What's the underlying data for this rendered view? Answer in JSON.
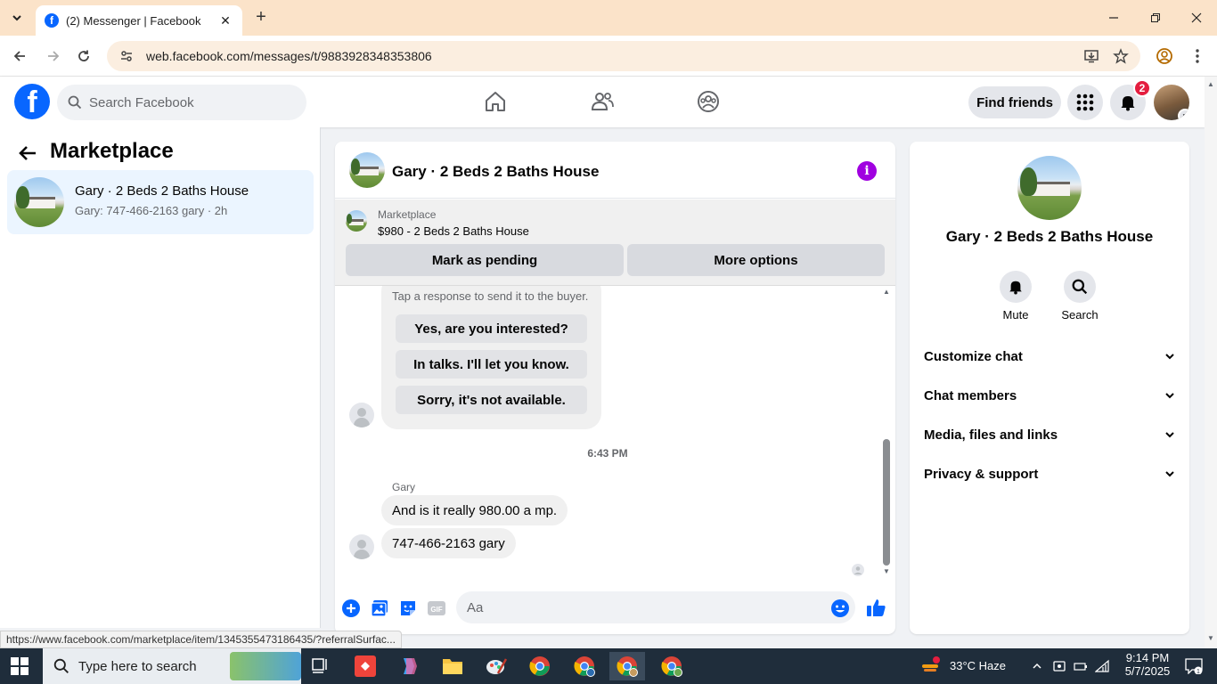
{
  "browser": {
    "tab_title": "(2) Messenger | Facebook",
    "url": "web.facebook.com/messages/t/9883928348353806",
    "status_url": "https://www.facebook.com/marketplace/item/1345355473186435/?referralSurfac..."
  },
  "fb_header": {
    "search_placeholder": "Search Facebook",
    "find_friends_label": "Find friends",
    "notification_count": "2"
  },
  "sidebar": {
    "title": "Marketplace",
    "conversation": {
      "title": "Gary · 2 Beds 2 Baths House",
      "preview": "Gary: 747-466-2163 gary · 2h"
    }
  },
  "chat": {
    "title": "Gary · 2 Beds 2 Baths House",
    "marketplace_label": "Marketplace",
    "listing": "$980 - 2 Beds 2 Baths House",
    "mark_pending_label": "Mark as pending",
    "more_options_label": "More options",
    "quick_hint": "Tap a response to send it to the buyer.",
    "quick_replies": [
      "Yes, are you interested?",
      "In talks. I'll let you know.",
      "Sorry, it's not available."
    ],
    "timestamp": "6:43 PM",
    "sender": "Gary",
    "messages": [
      "And is it really 980.00 a mp.",
      "747-466-2163 gary"
    ],
    "composer_placeholder": "Aa"
  },
  "info_panel": {
    "title": "Gary · 2 Beds 2 Baths House",
    "actions": [
      "Mute",
      "Search"
    ],
    "sections": [
      "Customize chat",
      "Chat members",
      "Media, files and links",
      "Privacy & support"
    ]
  },
  "taskbar": {
    "search_placeholder": "Type here to search",
    "weather": "33°C  Haze",
    "time": "9:14 PM",
    "date": "5/7/2025",
    "notification_badge": "1"
  },
  "colors": {
    "fb_blue": "#0866ff",
    "messenger_purple": "#a000e0",
    "badge_red": "#e41e3f"
  }
}
